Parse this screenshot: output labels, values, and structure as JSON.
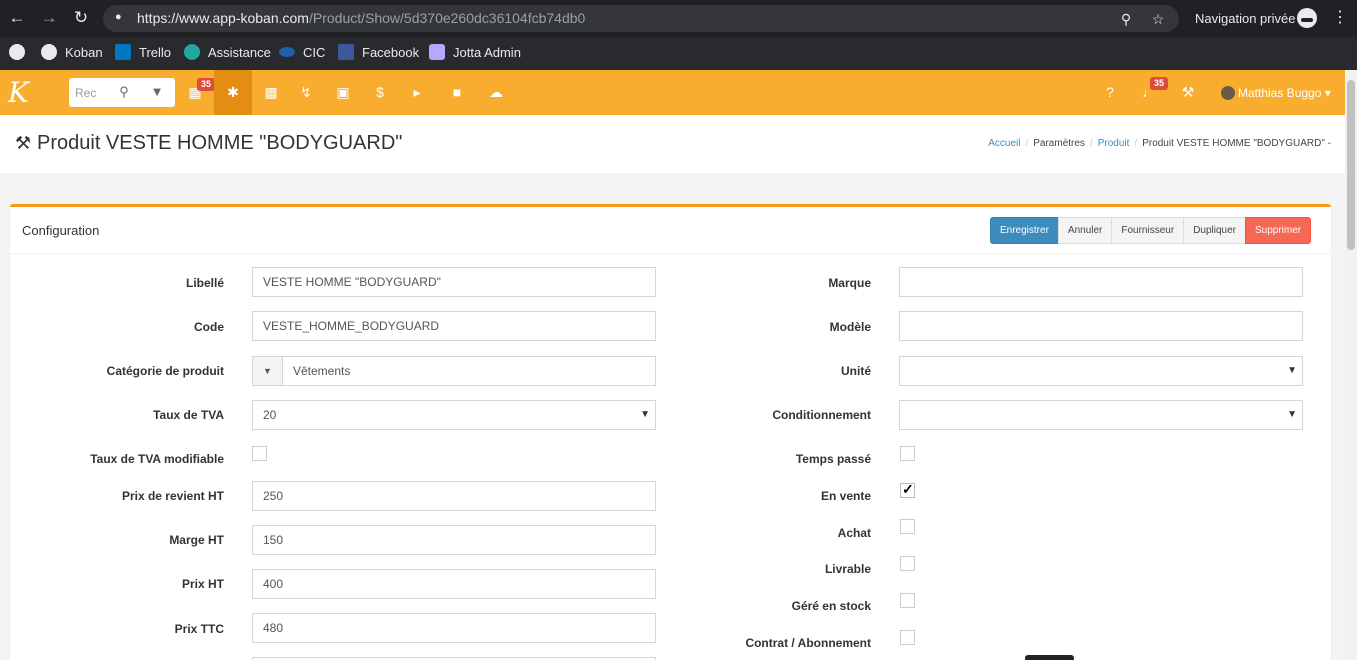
{
  "browser": {
    "url_host": "https://www.app-koban.com",
    "url_path": "/Product/Show/5d370e260dc36104fcb74db0",
    "private_label": "Navigation privée",
    "bookmarks": [
      {
        "label": "",
        "icon": "koban-icon",
        "color": "#e8eaed"
      },
      {
        "label": "Koban",
        "icon": "koban-icon",
        "color": "#e8eaed"
      },
      {
        "label": "Trello",
        "icon": "trello-icon",
        "color": "#0079bf"
      },
      {
        "label": "Assistance",
        "icon": "headset-icon",
        "color": "#20a8a0"
      },
      {
        "label": "CIC",
        "icon": "cic-icon",
        "color": "#1d5fa8"
      },
      {
        "label": "Facebook",
        "icon": "facebook-icon",
        "color": "#3b5998"
      },
      {
        "label": "Jotta Admin",
        "icon": "jotta-icon",
        "color": "#b8a6ff"
      }
    ]
  },
  "nav": {
    "search_placeholder": "Rec",
    "calendar_badge": "35",
    "notif_badge": "35",
    "user_name": "Matthias Buggo",
    "brand_color": "#f9ad2e",
    "active_color": "#e38d13",
    "icons": [
      "calendar-icon",
      "asterisk-icon",
      "building-icon",
      "bolt-icon",
      "money-icon",
      "dollar-icon",
      "bullhorn-icon",
      "puzzle-icon",
      "cloud-icon"
    ]
  },
  "header": {
    "title": "Produit VESTE HOMME \"BODYGUARD\"",
    "breadcrumb": {
      "home": "Accueil",
      "settings": "Paramètres",
      "product": "Produit",
      "current": "Produit VESTE HOMME \"BODYGUARD\" -"
    }
  },
  "box": {
    "title": "Configuration",
    "buttons": {
      "save": "Enregistrer",
      "cancel": "Annuler",
      "supplier": "Fournisseur",
      "duplicate": "Dupliquer",
      "delete": "Supprimer"
    }
  },
  "form": {
    "left": {
      "libelle": {
        "label": "Libellé",
        "value": "VESTE HOMME \"BODYGUARD\""
      },
      "code": {
        "label": "Code",
        "value": "VESTE_HOMME_BODYGUARD"
      },
      "categorie": {
        "label": "Catégorie de produit",
        "value": "Vêtements"
      },
      "tva": {
        "label": "Taux de TVA",
        "value": "20"
      },
      "tva_modifiable": {
        "label": "Taux de TVA modifiable",
        "checked": false
      },
      "prix_revient": {
        "label": "Prix de revient HT",
        "value": "250"
      },
      "marge": {
        "label": "Marge HT",
        "value": "150"
      },
      "prix_ht": {
        "label": "Prix HT",
        "value": "400"
      },
      "prix_ttc": {
        "label": "Prix TTC",
        "value": "480"
      }
    },
    "right": {
      "marque": {
        "label": "Marque",
        "value": ""
      },
      "modele": {
        "label": "Modèle",
        "value": ""
      },
      "unite": {
        "label": "Unité",
        "value": ""
      },
      "conditionnement": {
        "label": "Conditionnement",
        "value": ""
      },
      "temps_passe": {
        "label": "Temps passé",
        "checked": false
      },
      "en_vente": {
        "label": "En vente",
        "checked": true
      },
      "achat": {
        "label": "Achat",
        "checked": false
      },
      "livrable": {
        "label": "Livrable",
        "checked": false
      },
      "gere_stock": {
        "label": "Géré en stock",
        "checked": false
      },
      "contrat": {
        "label": "Contrat / Abonnement",
        "checked": false
      }
    }
  }
}
